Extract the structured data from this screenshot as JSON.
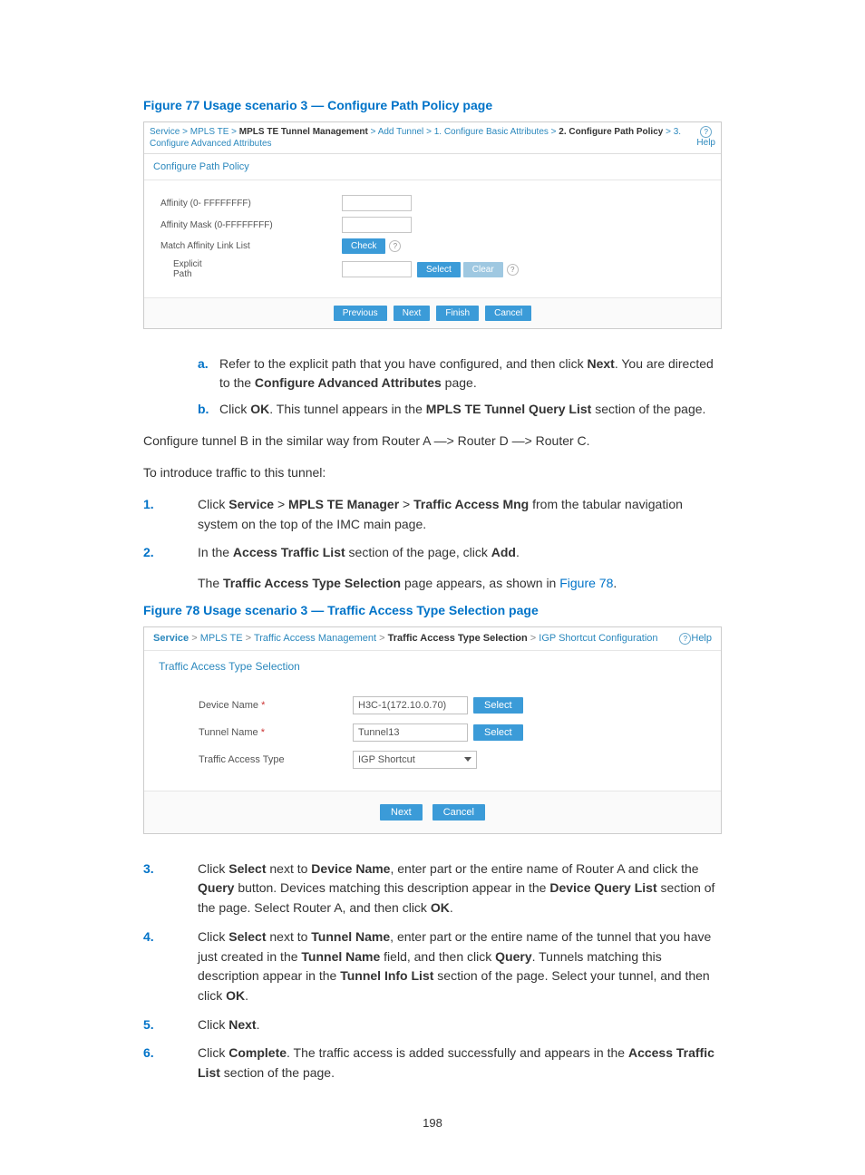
{
  "figure77": {
    "caption": "Figure 77 Usage scenario 3 — Configure Path Policy page",
    "breadcrumb": {
      "parts": [
        "Service",
        "MPLS TE"
      ],
      "bold1": "MPLS TE Tunnel Management",
      "mid": [
        "Add Tunnel",
        "1. Configure Basic Attributes"
      ],
      "bold2": "2. Configure Path Policy",
      "tail": "3. Configure Advanced Attributes"
    },
    "help": "Help",
    "panel_title": "Configure Path Policy",
    "affinity_label": "Affinity (0- FFFFFFFF)",
    "mask_label": "Affinity Mask (0-FFFFFFFF)",
    "linklist_label": "Match Affinity Link List",
    "check_btn": "Check",
    "explicit_label": "Explicit\nPath",
    "select_btn": "Select",
    "clear_btn": "Clear",
    "prev_btn": "Previous",
    "next_btn": "Next",
    "finish_btn": "Finish",
    "cancel_btn": "Cancel"
  },
  "steps_ab": {
    "a": {
      "mark": "a.",
      "t1": "Refer to the explicit path that you have configured, and then click ",
      "b1": "Next",
      "t2": ". You are directed to the ",
      "b2": "Configure Advanced Attributes",
      "t3": " page."
    },
    "b": {
      "mark": "b.",
      "t1": "Click ",
      "b1": "OK",
      "t2": ". This tunnel appears in the ",
      "b2": "MPLS TE Tunnel Query List",
      "t3": " section of the page."
    }
  },
  "para1": "Configure tunnel B in the similar way from Router A —> Router D —> Router C.",
  "para2": "To introduce traffic to this tunnel:",
  "num_steps": {
    "s1": {
      "n": "1.",
      "t1": "Click ",
      "b1": "Service",
      "sep1": " > ",
      "b2": "MPLS TE Manager",
      "sep2": " > ",
      "b3": "Traffic Access Mng",
      "t2": " from the tabular navigation system on the top of the IMC main page."
    },
    "s2": {
      "n": "2.",
      "line1": {
        "t1": "In the ",
        "b1": "Access Traffic List",
        "t2": " section of the page, click ",
        "b2": "Add",
        "t3": "."
      },
      "line2": {
        "t1": "The ",
        "b1": "Traffic Access Type Selection",
        "t2": " page appears, as shown in ",
        "link": "Figure 78",
        "t3": "."
      }
    }
  },
  "figure78": {
    "caption": "Figure 78 Usage scenario 3 — Traffic Access Type Selection page",
    "breadcrumb": {
      "service": "Service",
      "mpls": "MPLS TE",
      "tam": "Traffic Access Management",
      "bold": "Traffic Access Type Selection",
      "tail": "IGP Shortcut Configuration"
    },
    "help": "Help",
    "panel_title": "Traffic Access Type Selection",
    "device_label": "Device Name",
    "device_value": "H3C-1(172.10.0.70)",
    "tunnel_label": "Tunnel Name",
    "tunnel_value": "Tunnel13",
    "type_label": "Traffic Access Type",
    "type_value": "IGP Shortcut",
    "select_btn": "Select",
    "next_btn": "Next",
    "cancel_btn": "Cancel"
  },
  "num_steps2": {
    "s3": {
      "n": "3.",
      "t1": "Click ",
      "b1": "Select",
      "t2": " next to ",
      "b2": "Device Name",
      "t3": ", enter part or the entire name of Router A and click the ",
      "b3": "Query",
      "t4": " button. Devices matching this description appear in the ",
      "b4": "Device Query List",
      "t5": " section of the page. Select Router A, and then click ",
      "b5": "OK",
      "t6": "."
    },
    "s4": {
      "n": "4.",
      "t1": "Click ",
      "b1": "Select",
      "t2": " next to ",
      "b2": "Tunnel Name",
      "t3": ", enter part or the entire name of the tunnel that you have just created in the ",
      "b3": "Tunnel Name",
      "t4": " field, and then click ",
      "b4": "Query",
      "t5": ". Tunnels matching this description appear in the ",
      "b5": "Tunnel Info List",
      "t6": " section of the page. Select your tunnel, and then click ",
      "b6": "OK",
      "t7": "."
    },
    "s5": {
      "n": "5.",
      "t1": "Click ",
      "b1": "Next",
      "t2": "."
    },
    "s6": {
      "n": "6.",
      "t1": "Click ",
      "b1": "Complete",
      "t2": ". The traffic access is added successfully and appears in the ",
      "b2": "Access Traffic List",
      "t3": " section of the page."
    }
  },
  "page_number": "198"
}
